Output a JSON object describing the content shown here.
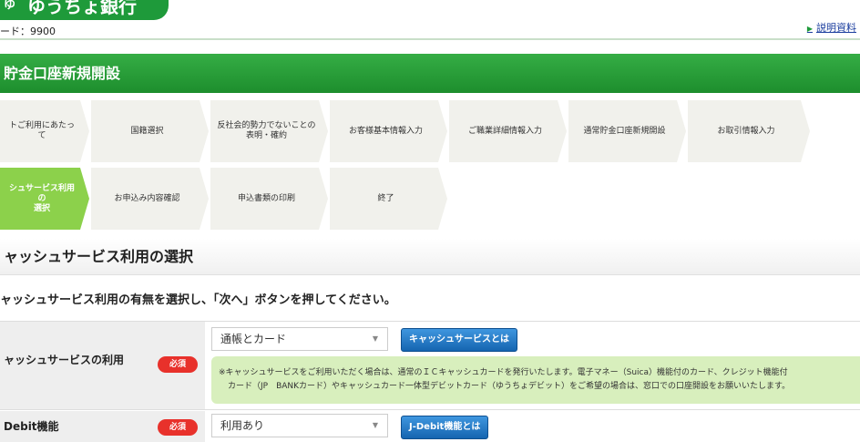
{
  "header": {
    "logo_mark": "ゆ",
    "bank_name": "ゆうちょ銀行",
    "branch_code": "ード：9900",
    "doc_link": "説明資料"
  },
  "page_title": "貯金口座新規開設",
  "steps": {
    "row1": [
      {
        "label": "トご利用にあたって"
      },
      {
        "label": "国籍選択"
      },
      {
        "label": "反社会的勢力でないことの\n表明・確約"
      },
      {
        "label": "お客様基本情報入力"
      },
      {
        "label": "ご職業詳細情報入力"
      },
      {
        "label": "通常貯金口座新規開設"
      },
      {
        "label": "お取引情報入力"
      }
    ],
    "row2": [
      {
        "label": "シュサービス利用の\n選択",
        "active": true
      },
      {
        "label": "お申込み内容確認"
      },
      {
        "label": "申込書類の印刷"
      },
      {
        "label": "終了"
      }
    ]
  },
  "section": {
    "heading": "ャッシュサービス利用の選択",
    "instruction": "ャッシュサービス利用の有無を選択し、「次へ」ボタンを押してください。"
  },
  "form": {
    "cash_service": {
      "label": "ャッシュサービスの利用",
      "required": "必須",
      "selected": "通帳とカード",
      "info_button": "キャッシュサービスとは",
      "note_line1": "※キャッシュサービスをご利用いただく場合は、通常のＩＣキャッシュカードを発行いたします。電子マネー（Suica）機能付のカード、クレジット機能付",
      "note_line2": "カード（JP　BANKカード）やキャッシュカード一体型デビットカード（ゆうちょデビット）をご希望の場合は、窓口での口座開設をお願いいたします。"
    },
    "jdebit": {
      "label": "Debit機能",
      "required": "必須",
      "selected": "利用あり",
      "info_button": "J-Debit機能とは"
    }
  },
  "colors": {
    "brand_green": "#1e9a3a",
    "active_step": "#8cd14b",
    "required_red": "#e8312b",
    "info_blue": "#1565b0",
    "note_bg": "#d8efbd"
  }
}
